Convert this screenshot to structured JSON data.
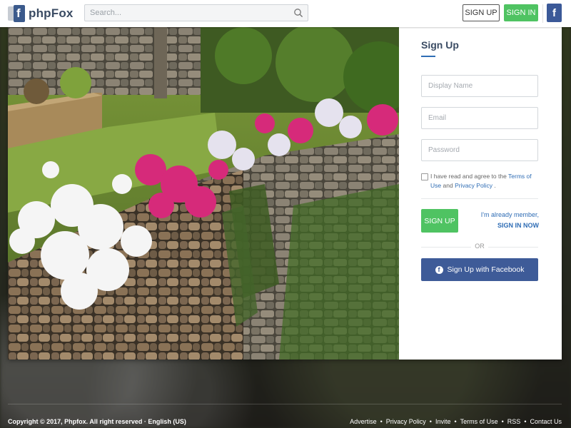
{
  "brand": {
    "name": "phpFox"
  },
  "search": {
    "placeholder": "Search..."
  },
  "header": {
    "signup_label": "SIGN UP",
    "signin_label": "SIGN IN",
    "facebook_glyph": "f"
  },
  "signup_form": {
    "title": "Sign Up",
    "display_name_placeholder": "Display Name",
    "email_placeholder": "Email",
    "password_placeholder": "Password",
    "terms_prefix": "I have read and agree to the",
    "terms_link": "Terms of Use",
    "terms_and": "and",
    "privacy_link": "Privacy Policy",
    "terms_suffix": ".",
    "submit_label": "SIGN UP",
    "already_member": "I'm already member,",
    "sign_in_now": "SIGN IN NOW",
    "or_label": "OR",
    "facebook_label": "Sign Up with Facebook"
  },
  "footer": {
    "copyright": "Copyright © 2017, Phpfox. All right reserved · English (US)",
    "links": [
      "Advertise",
      "Privacy Policy",
      "Invite",
      "Terms of Use",
      "RSS",
      "Contact Us"
    ]
  },
  "colors": {
    "accent_green": "#4fc362",
    "facebook_blue": "#3b5998",
    "link_blue": "#2f6db5"
  }
}
